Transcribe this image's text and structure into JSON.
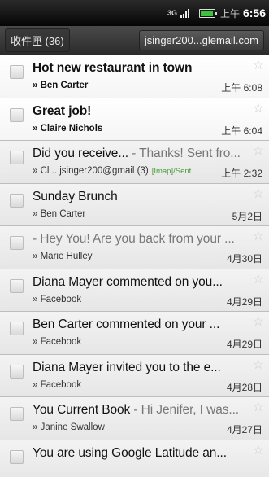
{
  "status_bar": {
    "network": "3G",
    "am_pm": "上午",
    "clock": "6:56"
  },
  "header": {
    "folder": "收件匣 (36)",
    "account": "jsinger200...glemail.com"
  },
  "emails": [
    {
      "subject": "Hot new restaurant in town",
      "snippet": "",
      "sender": "» Ben Carter",
      "folder_tag": "",
      "date": "上午 6:08",
      "unread": true
    },
    {
      "subject": "Great job!",
      "snippet": "",
      "sender": "» Claire Nichols",
      "folder_tag": "",
      "date": "上午 6:04",
      "unread": true
    },
    {
      "subject": "Did you receive...",
      "snippet": " - Thanks! Sent fro...",
      "sender": "» Cl .. jsinger200@gmail (3)",
      "folder_tag": "[Imap]/Sent",
      "date": "上午 2:32",
      "unread": false
    },
    {
      "subject": "Sunday Brunch",
      "snippet": "",
      "sender": "» Ben Carter",
      "folder_tag": "",
      "date": "5月2日",
      "unread": false
    },
    {
      "subject": "",
      "snippet": " - Hey You! Are you back from your ...",
      "sender": "» Marie Hulley",
      "folder_tag": "",
      "date": "4月30日",
      "unread": false
    },
    {
      "subject": "Diana Mayer commented on you...",
      "snippet": "",
      "sender": "» Facebook",
      "folder_tag": "",
      "date": "4月29日",
      "unread": false
    },
    {
      "subject": "Ben Carter commented on your ...",
      "snippet": "",
      "sender": "» Facebook",
      "folder_tag": "",
      "date": "4月29日",
      "unread": false
    },
    {
      "subject": "Diana Mayer invited you to the e...",
      "snippet": "",
      "sender": "» Facebook",
      "folder_tag": "",
      "date": "4月28日",
      "unread": false
    },
    {
      "subject": "You Current Book",
      "snippet": " - Hi Jenifer, I was...",
      "sender": "» Janine Swallow",
      "folder_tag": "",
      "date": "4月27日",
      "unread": false
    },
    {
      "subject": "You are using Google Latitude an...",
      "snippet": "",
      "sender": "",
      "folder_tag": "",
      "date": "",
      "unread": false
    }
  ],
  "icons": {
    "star": "star-icon",
    "checkbox": "checkbox",
    "signal": "signal-icon",
    "battery": "battery-icon"
  }
}
